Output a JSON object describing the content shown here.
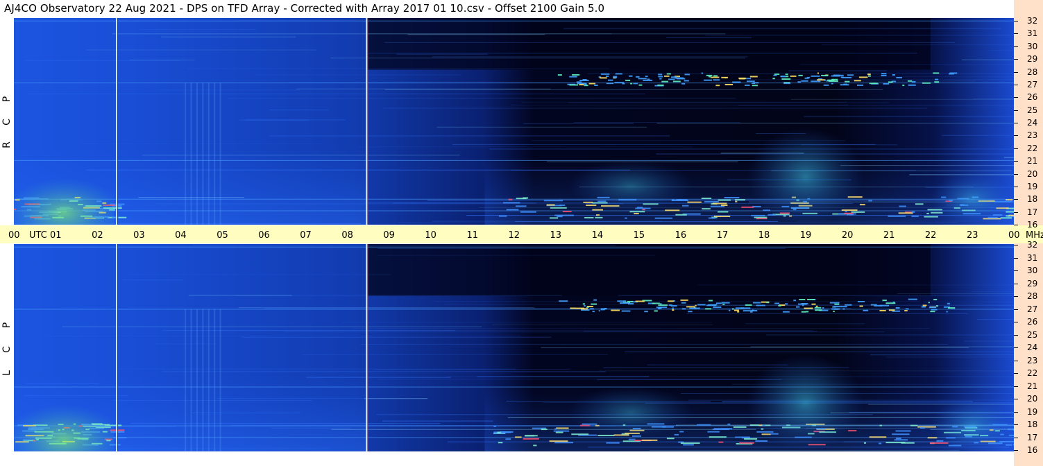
{
  "title": "AJ4CO Observatory  22 Aug 2021  -  DPS on TFD Array  -  Corrected with Array 2017 01 10.csv  -  Offset 2100  Gain 5.0",
  "chart_data": {
    "type": "heatmap",
    "x_axis": {
      "unit_label": "UTC",
      "ticks": [
        "00",
        "01",
        "02",
        "03",
        "04",
        "05",
        "06",
        "07",
        "08",
        "09",
        "10",
        "11",
        "12",
        "13",
        "14",
        "15",
        "16",
        "17",
        "18",
        "19",
        "20",
        "21",
        "22",
        "23",
        "00"
      ],
      "range_hours": [
        0,
        24
      ]
    },
    "y_axis": {
      "unit_label": "MHz",
      "ticks": [
        "32",
        "31",
        "30",
        "29",
        "28",
        "27",
        "26",
        "25",
        "24",
        "23",
        "22",
        "21",
        "20",
        "19",
        "18",
        "17",
        "16"
      ],
      "range_mhz": [
        16,
        32
      ]
    },
    "panels": [
      {
        "id": "rcp",
        "letters": [
          "R",
          "C",
          "P"
        ]
      },
      {
        "id": "lcp",
        "letters": [
          "L",
          "C",
          "P"
        ]
      }
    ],
    "features": {
      "calibration_lines_utc": [
        2.45,
        8.45
      ],
      "storm_band_mhz": [
        26.8,
        27.8
      ],
      "bright_band_mhz": [
        16.5,
        18.2
      ]
    },
    "colors": {
      "background": "#02031a",
      "ionosphere": "#1848d0",
      "high": "#60e0a0",
      "peak": "#ff4060"
    }
  }
}
